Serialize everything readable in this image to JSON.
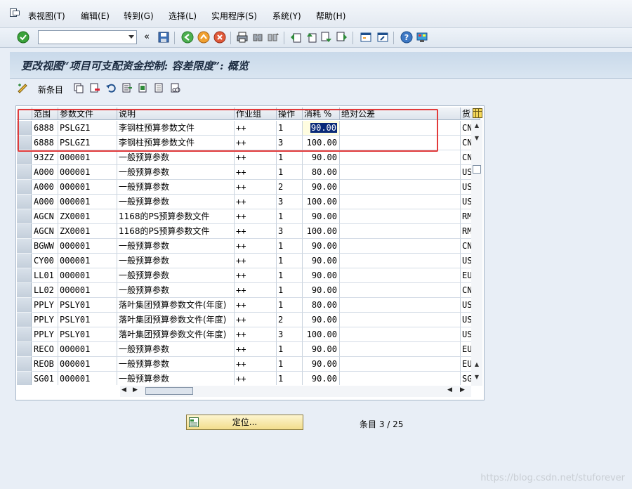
{
  "menu": {
    "items": [
      "表视图(T)",
      "编辑(E)",
      "转到(G)",
      "选择(L)",
      "实用程序(S)",
      "系统(Y)",
      "帮助(H)"
    ]
  },
  "toolbar": {
    "command_value": "",
    "icons": [
      "enter-icon",
      "save-icon",
      "back-icon",
      "exit-icon",
      "cancel-icon",
      "print-icon",
      "find-icon",
      "find-next-icon",
      "first-page-icon",
      "prev-page-icon",
      "next-page-icon",
      "last-page-icon",
      "new-session-icon",
      "shortcut-icon",
      "help-icon",
      "customize-icon"
    ]
  },
  "title": "更改视图“项目可支配资金控制: 容差限度”:  概览",
  "app_toolbar": {
    "new_entries_label": "新条目"
  },
  "table": {
    "columns": [
      "范围",
      "参数文件",
      "说明",
      "作业组",
      "操作",
      "消耗 %",
      "绝对公差",
      "货"
    ],
    "rows": [
      [
        "6888",
        "PSLGZ1",
        "李钢柱预算参数文件",
        "++",
        "1",
        "90.00",
        "",
        "CN"
      ],
      [
        "6888",
        "PSLGZ1",
        "李钢柱预算参数文件",
        "++",
        "3",
        "100.00",
        "",
        "CN"
      ],
      [
        "93ZZ",
        "000001",
        "一般预算参数",
        "++",
        "1",
        "90.00",
        "",
        "CN"
      ],
      [
        "A000",
        "000001",
        "一般预算参数",
        "++",
        "1",
        "80.00",
        "",
        "US"
      ],
      [
        "A000",
        "000001",
        "一般预算参数",
        "++",
        "2",
        "90.00",
        "",
        "US"
      ],
      [
        "A000",
        "000001",
        "一般预算参数",
        "++",
        "3",
        "100.00",
        "",
        "US"
      ],
      [
        "AGCN",
        "ZX0001",
        "1168的PS预算参数文件",
        "++",
        "1",
        "90.00",
        "",
        "RM"
      ],
      [
        "AGCN",
        "ZX0001",
        "1168的PS预算参数文件",
        "++",
        "3",
        "100.00",
        "",
        "RM"
      ],
      [
        "BGWW",
        "000001",
        "一般预算参数",
        "++",
        "1",
        "90.00",
        "",
        "CN"
      ],
      [
        "CY00",
        "000001",
        "一般预算参数",
        "++",
        "1",
        "90.00",
        "",
        "US"
      ],
      [
        "LL01",
        "000001",
        "一般预算参数",
        "++",
        "1",
        "90.00",
        "",
        "EU"
      ],
      [
        "LL02",
        "000001",
        "一般预算参数",
        "++",
        "1",
        "90.00",
        "",
        "CN"
      ],
      [
        "PPLY",
        "PSLY01",
        "落叶集团预算参数文件(年度)",
        "++",
        "1",
        "80.00",
        "",
        "US"
      ],
      [
        "PPLY",
        "PSLY01",
        "落叶集团预算参数文件(年度)",
        "++",
        "2",
        "90.00",
        "",
        "US"
      ],
      [
        "PPLY",
        "PSLY01",
        "落叶集团预算参数文件(年度)",
        "++",
        "3",
        "100.00",
        "",
        "US"
      ],
      [
        "RECO",
        "000001",
        "一般预算参数",
        "++",
        "1",
        "90.00",
        "",
        "EU"
      ],
      [
        "REOB",
        "000001",
        "一般预算参数",
        "++",
        "1",
        "90.00",
        "",
        "EU"
      ],
      [
        "SG01",
        "000001",
        "一般预算参数",
        "++",
        "1",
        "90.00",
        "",
        "SG"
      ]
    ]
  },
  "position_button_label": "定位...",
  "entry_counter": "条目 3 / 25",
  "watermark": "https://blog.csdn.net/stuforever",
  "colors": {
    "annotation_red": "#e23b3b",
    "selected_value_bg": "#0a2a78"
  }
}
